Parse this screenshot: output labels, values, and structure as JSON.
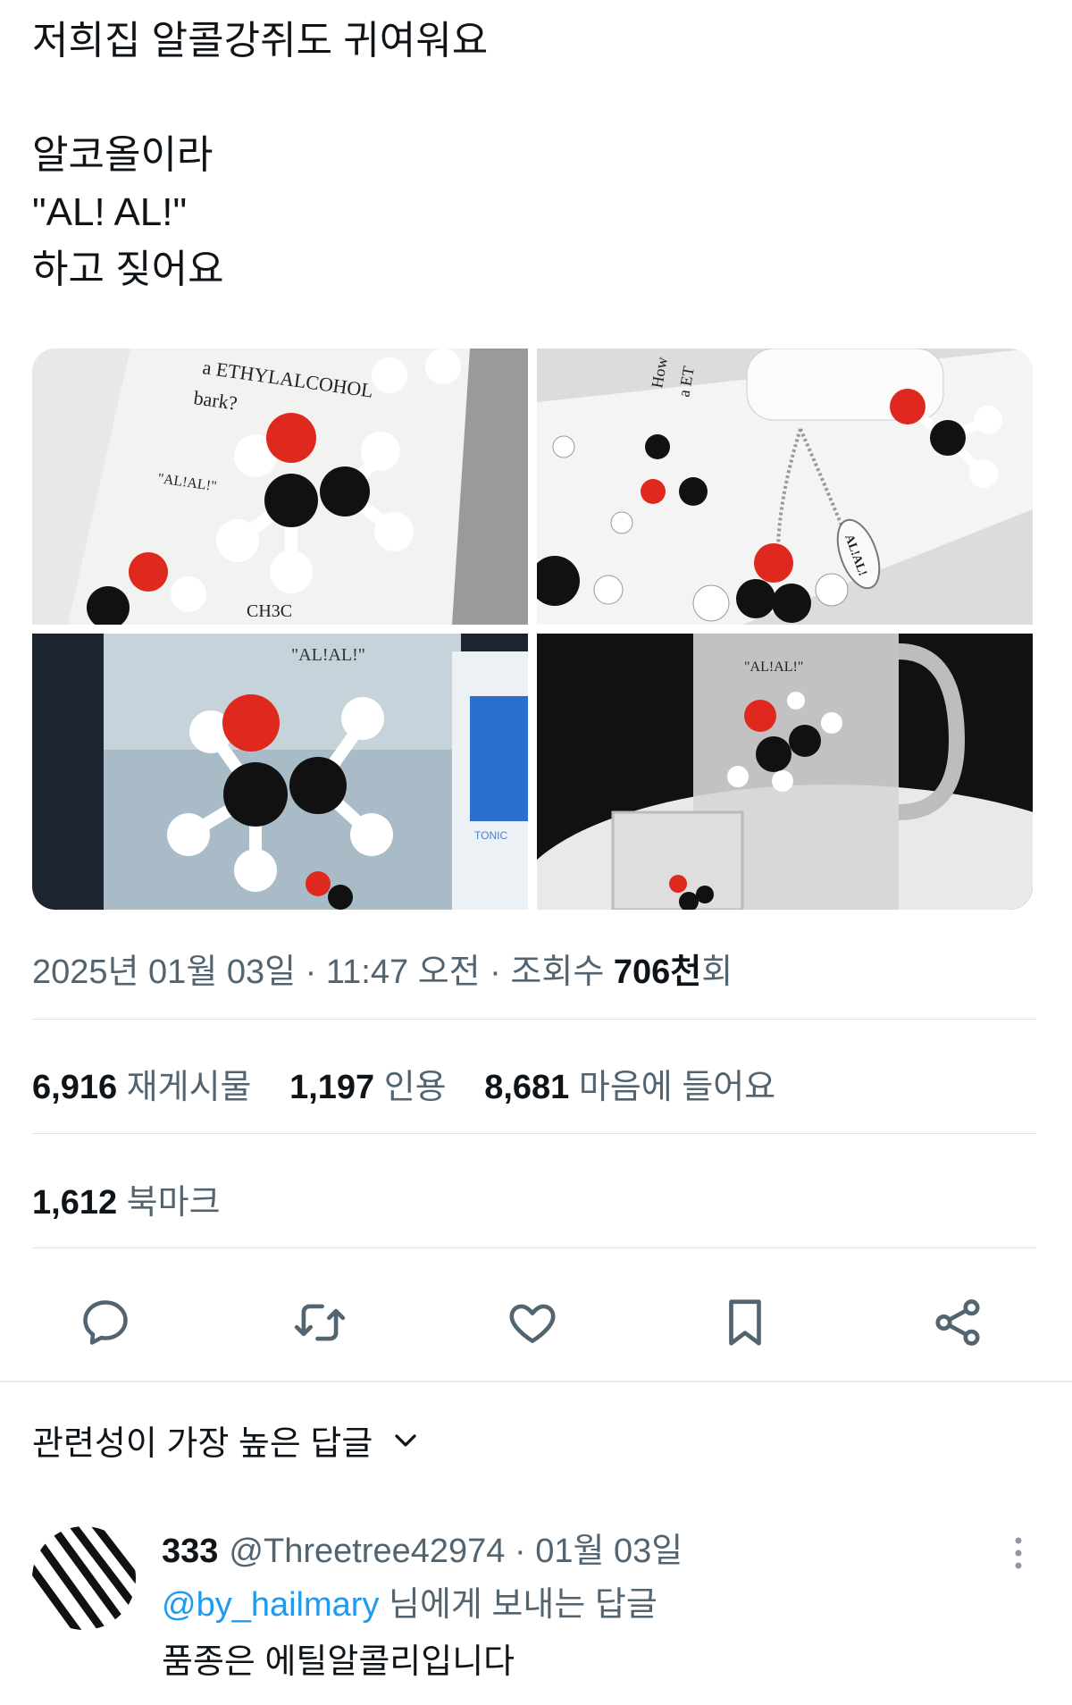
{
  "tweet": {
    "lines": [
      "저희집 알콜강쥐도 귀여워요",
      "알코올이라",
      "\"AL! AL!\"",
      "하고 짖어요"
    ]
  },
  "media": {
    "photos": [
      {
        "texts": [
          "a ETHYLALCOHOL",
          "bark?",
          "\"AL!AL!\"",
          "CH3C"
        ]
      },
      {
        "texts": [
          "How",
          "a ET",
          "AL!AL!"
        ]
      },
      {
        "texts": [
          "\"AL!AL!\"",
          "TONIC"
        ]
      },
      {
        "texts": [
          "\"AL!AL!\""
        ]
      }
    ]
  },
  "meta": {
    "date": "2025년 01월 03일",
    "sep1": " · ",
    "time": "11:47 오전",
    "sep2": " · ",
    "views_label": "조회수 ",
    "views_num": "706천",
    "views_suffix": "회"
  },
  "stats": {
    "retweets_num": "6,916",
    "retweets_label": "재게시물",
    "quotes_num": "1,197",
    "quotes_label": "인용",
    "likes_num": "8,681",
    "likes_label": "마음에 들어요",
    "bookmarks_num": "1,612",
    "bookmarks_label": "북마크"
  },
  "actions": [
    "reply-icon",
    "retweet-icon",
    "like-icon",
    "bookmark-icon",
    "share-icon"
  ],
  "sort": {
    "label": "관련성이 가장 높은 답글"
  },
  "reply": {
    "name": "333",
    "handle": "@Threetree42974",
    "sep": " · ",
    "date": "01월 03일",
    "mention": "@by_hailmary",
    "reply_suffix": " 님에게 보내는 답글",
    "text": "품종은 에틸알콜리입니다"
  },
  "colors": {
    "accent": "#1d9bf0",
    "text": "#0f1419",
    "secondary": "#536471",
    "oxygen": "#e0291e"
  }
}
